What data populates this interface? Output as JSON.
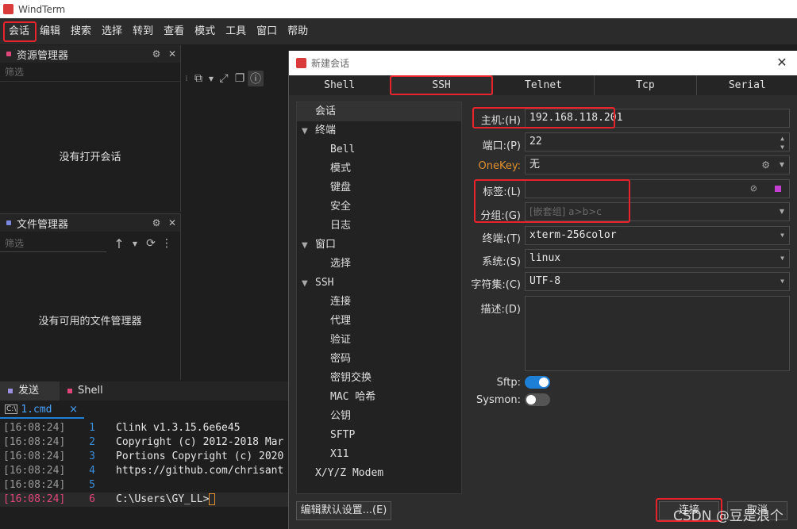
{
  "window": {
    "title": "WindTerm"
  },
  "menu": [
    "会话",
    "编辑",
    "搜索",
    "选择",
    "转到",
    "查看",
    "模式",
    "工具",
    "窗口",
    "帮助"
  ],
  "resource_panel": {
    "title": "资源管理器",
    "filter_placeholder": "筛选",
    "empty": "没有打开会话"
  },
  "file_panel": {
    "title": "文件管理器",
    "filter_placeholder": "筛选",
    "empty": "没有可用的文件管理器"
  },
  "bottom_tabs": {
    "send": "发送",
    "shell": "Shell"
  },
  "cmd_tab": {
    "label": "1.cmd",
    "close": "×"
  },
  "terminal": {
    "lines": [
      {
        "ts": "[16:08:24]",
        "n": "1",
        "text": "Clink v1.3.15.6e6e45"
      },
      {
        "ts": "[16:08:24]",
        "n": "2",
        "text": "Copyright (c) 2012-2018 Mar"
      },
      {
        "ts": "[16:08:24]",
        "n": "3",
        "text": "Portions Copyright (c) 2020"
      },
      {
        "ts": "[16:08:24]",
        "n": "4",
        "text": "https://github.com/chrisant"
      },
      {
        "ts": "[16:08:24]",
        "n": "5",
        "text": ""
      },
      {
        "ts": "[16:08:24]",
        "n": "6",
        "text": "C:\\Users\\GY_LL>"
      }
    ]
  },
  "dialog": {
    "title": "新建会话",
    "close": "✕",
    "tabs": [
      "Shell",
      "SSH",
      "Telnet",
      "Tcp",
      "Serial"
    ],
    "tree": [
      {
        "label": "会话",
        "level": 0,
        "arrow": ""
      },
      {
        "label": "终端",
        "level": 0,
        "arrow": "▼"
      },
      {
        "label": "Bell",
        "level": 1,
        "arrow": ""
      },
      {
        "label": "模式",
        "level": 1,
        "arrow": ""
      },
      {
        "label": "键盘",
        "level": 1,
        "arrow": ""
      },
      {
        "label": "安全",
        "level": 1,
        "arrow": ""
      },
      {
        "label": "日志",
        "level": 1,
        "arrow": ""
      },
      {
        "label": "窗口",
        "level": 0,
        "arrow": "▼"
      },
      {
        "label": "选择",
        "level": 1,
        "arrow": ""
      },
      {
        "label": "SSH",
        "level": 0,
        "arrow": "▼"
      },
      {
        "label": "连接",
        "level": 1,
        "arrow": ""
      },
      {
        "label": "代理",
        "level": 1,
        "arrow": ""
      },
      {
        "label": "验证",
        "level": 1,
        "arrow": ""
      },
      {
        "label": "密码",
        "level": 1,
        "arrow": ""
      },
      {
        "label": "密钥交换",
        "level": 1,
        "arrow": ""
      },
      {
        "label": "MAC 哈希",
        "level": 1,
        "arrow": ""
      },
      {
        "label": "公钥",
        "level": 1,
        "arrow": ""
      },
      {
        "label": "SFTP",
        "level": 1,
        "arrow": ""
      },
      {
        "label": "X11",
        "level": 1,
        "arrow": ""
      },
      {
        "label": "X/Y/Z Modem",
        "level": 0,
        "arrow": ""
      }
    ],
    "fields": {
      "host_label": "主机:(H)",
      "host_value": "192.168.118.201",
      "port_label": "端口:(P)",
      "port_value": "22",
      "onekey_label": "OneKey:",
      "onekey_value": "无",
      "tag_label": "标签:(L)",
      "tag_value": "",
      "group_label": "分组:(G)",
      "group_placeholder": "[嵌套组] a>b>c",
      "terminal_label": "终端:(T)",
      "terminal_value": "xterm-256color",
      "system_label": "系统:(S)",
      "system_value": "linux",
      "charset_label": "字符集:(C)",
      "charset_value": "UTF-8",
      "desc_label": "描述:(D)",
      "desc_value": "",
      "sftp_label": "Sftp:",
      "sftp_on": true,
      "sysmon_label": "Sysmon:",
      "sysmon_on": false
    },
    "edit_default_button": "编辑默认设置...(E)",
    "ok_button": "连接",
    "cancel_button": "取消"
  },
  "watermark": "CSDN @豆是浪个",
  "colors": {
    "accent_red": "#e8232b",
    "toggle_on": "#1e7fd6",
    "onekey_orange": "#e0902e",
    "term_pink": "#e0467a"
  }
}
